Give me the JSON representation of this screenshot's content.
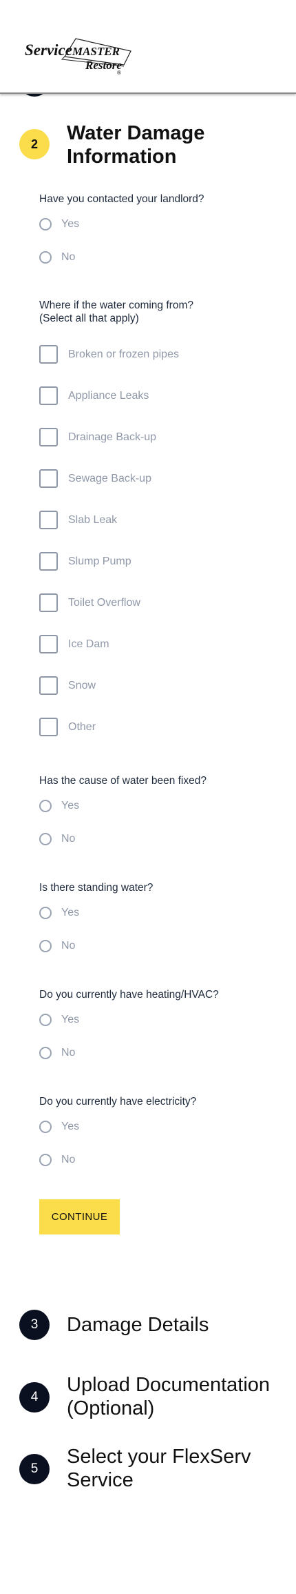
{
  "header": {
    "logo": {
      "brand_line1": "ServiceMASTER",
      "brand_line2": "Restore",
      "mark": "®"
    }
  },
  "steps": [
    {
      "number": "2",
      "title": "Water Damage Information",
      "state": "active"
    },
    {
      "number": "3",
      "title": "Damage Details",
      "state": "collapsed"
    },
    {
      "number": "4",
      "title": "Upload Documentation (Optional)",
      "state": "collapsed"
    },
    {
      "number": "5",
      "title": "Select your FlexServ Service",
      "state": "collapsed"
    }
  ],
  "form": {
    "q_landlord": {
      "label": "Have you contacted your landlord?",
      "options": [
        "Yes",
        "No"
      ]
    },
    "q_source": {
      "label": "Where if the water coming from? (Select all that apply)",
      "options": [
        "Broken or frozen pipes",
        "Appliance Leaks",
        "Drainage Back-up",
        "Sewage Back-up",
        "Slab Leak",
        "Slump Pump",
        "Toilet Overflow",
        "Ice Dam",
        "Snow",
        "Other"
      ]
    },
    "q_fixed": {
      "label": "Has the cause of water been fixed?",
      "options": [
        "Yes",
        "No"
      ]
    },
    "q_standing": {
      "label": "Is there standing water?",
      "options": [
        "Yes",
        "No"
      ]
    },
    "q_hvac": {
      "label": "Do you currently have heating/HVAC?",
      "options": [
        "Yes",
        "No"
      ]
    },
    "q_electricity": {
      "label": "Do you currently have electricity?",
      "options": [
        "Yes",
        "No"
      ]
    },
    "continue_label": "CONTINUE"
  },
  "colors": {
    "accent_yellow": "#fbdc4a",
    "dark_navy": "#0b1020",
    "option_gray": "#8f98a8"
  }
}
